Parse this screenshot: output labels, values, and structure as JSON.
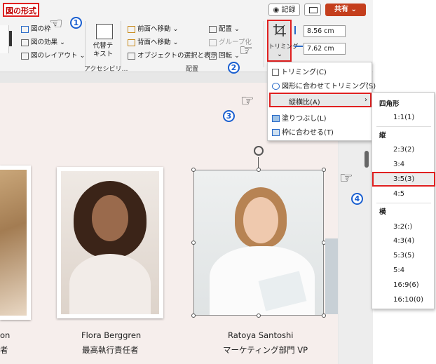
{
  "ribbon": {
    "tab_picture_format": "図の形式",
    "record_label": "◉ 記録",
    "share_label": "共有",
    "items": {
      "pic_border": "図の枠",
      "pic_effect": "図の効果",
      "pic_layout": "図のレイアウト",
      "alt_text": "代替テキスト",
      "bring_forward": "前面へ移動",
      "send_backward": "背面へ移動",
      "selection_pane": "オブジェクトの選択と表示",
      "align": "配置",
      "group": "グループ化",
      "rotate": "回転",
      "crop": "トリミング",
      "height": "8.56 cm",
      "width": "7.62 cm"
    },
    "group_labels": {
      "accessibility": "アクセシビリ…",
      "arrange": "配置"
    }
  },
  "slide": {
    "people": [
      {
        "name": "Flora Berggren",
        "title": "最高執行責任者"
      },
      {
        "name": "Ratoya Santoshi",
        "title": "マーケティング部門 VP"
      }
    ],
    "left_partial_name": "on",
    "left_partial_title": "者"
  },
  "crop_menu": {
    "items": [
      "トリミング(C)",
      "図形に合わせてトリミング(S)",
      "縦横比(A)",
      "塗りつぶし(L)",
      "枠に合わせる(T)"
    ]
  },
  "aspect_menu": {
    "square_header": "四角形",
    "square": [
      "1:1(1)"
    ],
    "portrait_header": "縦",
    "portrait": [
      "2:3(2)",
      "3:4",
      "3:5(3)",
      "4:5"
    ],
    "landscape_header": "横",
    "landscape": [
      "3:2(:)",
      "4:3(4)",
      "5:3(5)",
      "5:4",
      "16:9(6)",
      "16:10(0)"
    ]
  },
  "steps": [
    "1",
    "2",
    "3",
    "4"
  ]
}
